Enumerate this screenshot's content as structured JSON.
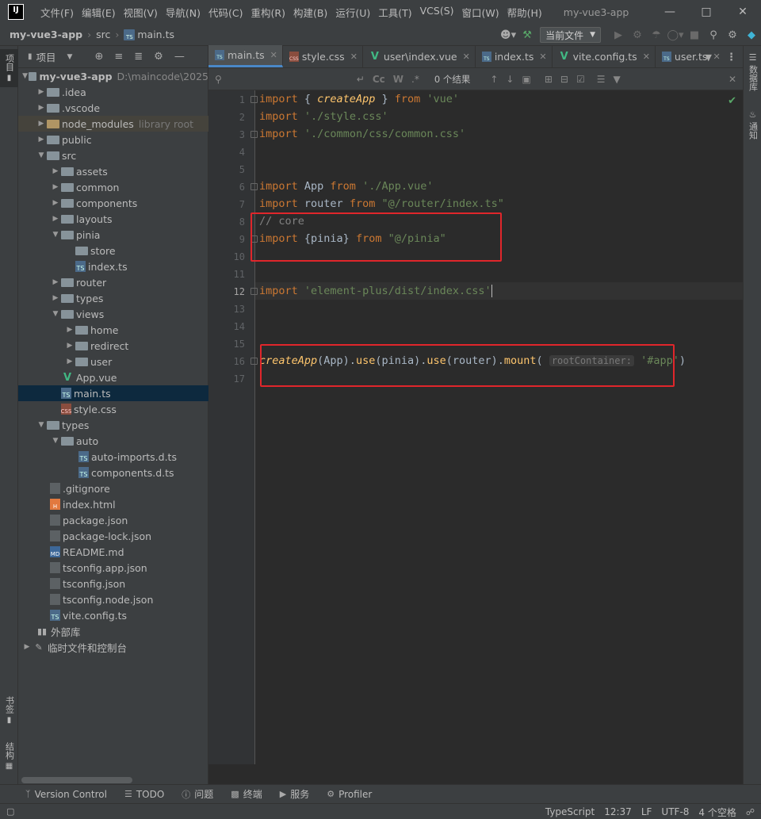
{
  "app": {
    "logo_text": "IJ",
    "window_title": "my-vue3-app"
  },
  "menu": [
    "文件(F)",
    "编辑(E)",
    "视图(V)",
    "导航(N)",
    "代码(C)",
    "重构(R)",
    "构建(B)",
    "运行(U)",
    "工具(T)",
    "VCS(S)",
    "窗口(W)",
    "帮助(H)"
  ],
  "breadcrumb": {
    "project": "my-vue3-app",
    "folder": "src",
    "file": "main.ts"
  },
  "toolbar": {
    "run_config": "当前文件"
  },
  "left_stripe": {
    "project": "项目",
    "bookmarks": "书签",
    "structure": "结构"
  },
  "right_stripe": {
    "database": "数据库",
    "notifications": "通知"
  },
  "project_panel": {
    "title": "项目",
    "root_name": "my-vue3-app",
    "root_path": "D:\\maincode\\2025",
    "library_root": "library root",
    "items": {
      "idea": ".idea",
      "vscode": ".vscode",
      "node_modules": "node_modules",
      "public": "public",
      "src": "src",
      "assets": "assets",
      "common": "common",
      "components": "components",
      "layouts": "layouts",
      "pinia": "pinia",
      "store": "store",
      "pinia_index": "index.ts",
      "router": "router",
      "types": "types",
      "views": "views",
      "home": "home",
      "redirect": "redirect",
      "user": "user",
      "app_vue": "App.vue",
      "main_ts": "main.ts",
      "style_css": "style.css",
      "root_types": "types",
      "auto": "auto",
      "auto_imports": "auto-imports.d.ts",
      "components_dts": "components.d.ts",
      "gitignore": ".gitignore",
      "index_html": "index.html",
      "package_json": "package.json",
      "package_lock": "package-lock.json",
      "readme": "README.md",
      "tsconfig_app": "tsconfig.app.json",
      "tsconfig": "tsconfig.json",
      "tsconfig_node": "tsconfig.node.json",
      "vite_config": "vite.config.ts",
      "external_libs": "外部库",
      "scratches": "临时文件和控制台"
    }
  },
  "tabs": [
    "main.ts",
    "style.css",
    "user\\index.vue",
    "index.ts",
    "vite.config.ts",
    "user.ts"
  ],
  "find": {
    "count": "0 个结果",
    "cc": "Cc",
    "w": "W"
  },
  "code": {
    "line_numbers": [
      "1",
      "2",
      "3",
      "4",
      "5",
      "6",
      "7",
      "8",
      "9",
      "10",
      "11",
      "12",
      "13",
      "14",
      "15",
      "16",
      "17"
    ],
    "l1": {
      "kw1": "import",
      "p1": " { ",
      "fn": "createApp",
      "p2": " } ",
      "kw2": "from",
      "sp": " ",
      "str": "'vue'"
    },
    "l2": {
      "kw": "import",
      "sp": " ",
      "str": "'./style.css'"
    },
    "l3": {
      "kw": "import",
      "sp": " ",
      "str": "'./common/css/common.css'"
    },
    "l6": {
      "kw1": "import",
      "id": " App ",
      "kw2": "from",
      "sp": " ",
      "str": "'./App.vue'"
    },
    "l7": {
      "kw1": "import",
      "id": " router ",
      "kw2": "from",
      "sp": " ",
      "str": "\"@/router/index.ts\""
    },
    "l8": {
      "cmt": "// core"
    },
    "l9": {
      "kw1": "import",
      "id": " {pinia} ",
      "kw2": "from",
      "sp": " ",
      "str": "\"@/pinia\""
    },
    "l12": {
      "kw": "import",
      "sp": " ",
      "str": "'element-plus/dist/index.css'"
    },
    "l16": {
      "fn1": "createApp",
      "p1": "(App).",
      "fn2": "use",
      "p2": "(pinia).",
      "fn3": "use",
      "p3": "(router).",
      "fn4": "mount",
      "p4": "( ",
      "hint": "rootContainer:",
      "sp": " ",
      "str": "'#app'",
      "p5": ")"
    }
  },
  "bottom_tools": {
    "vcs": "Version Control",
    "todo": "TODO",
    "problems": "问题",
    "terminal": "终端",
    "services": "服务",
    "profiler": "Profiler"
  },
  "status": {
    "lang": "TypeScript",
    "pos": "12:37",
    "eol": "LF",
    "enc": "UTF-8",
    "indent": "4 个空格"
  },
  "colors": {
    "keyword": "#cc7832",
    "string": "#6a8759",
    "function": "#ffc66d",
    "comment": "#808080",
    "highlight": "#e0262b",
    "selection": "#0d293e"
  }
}
